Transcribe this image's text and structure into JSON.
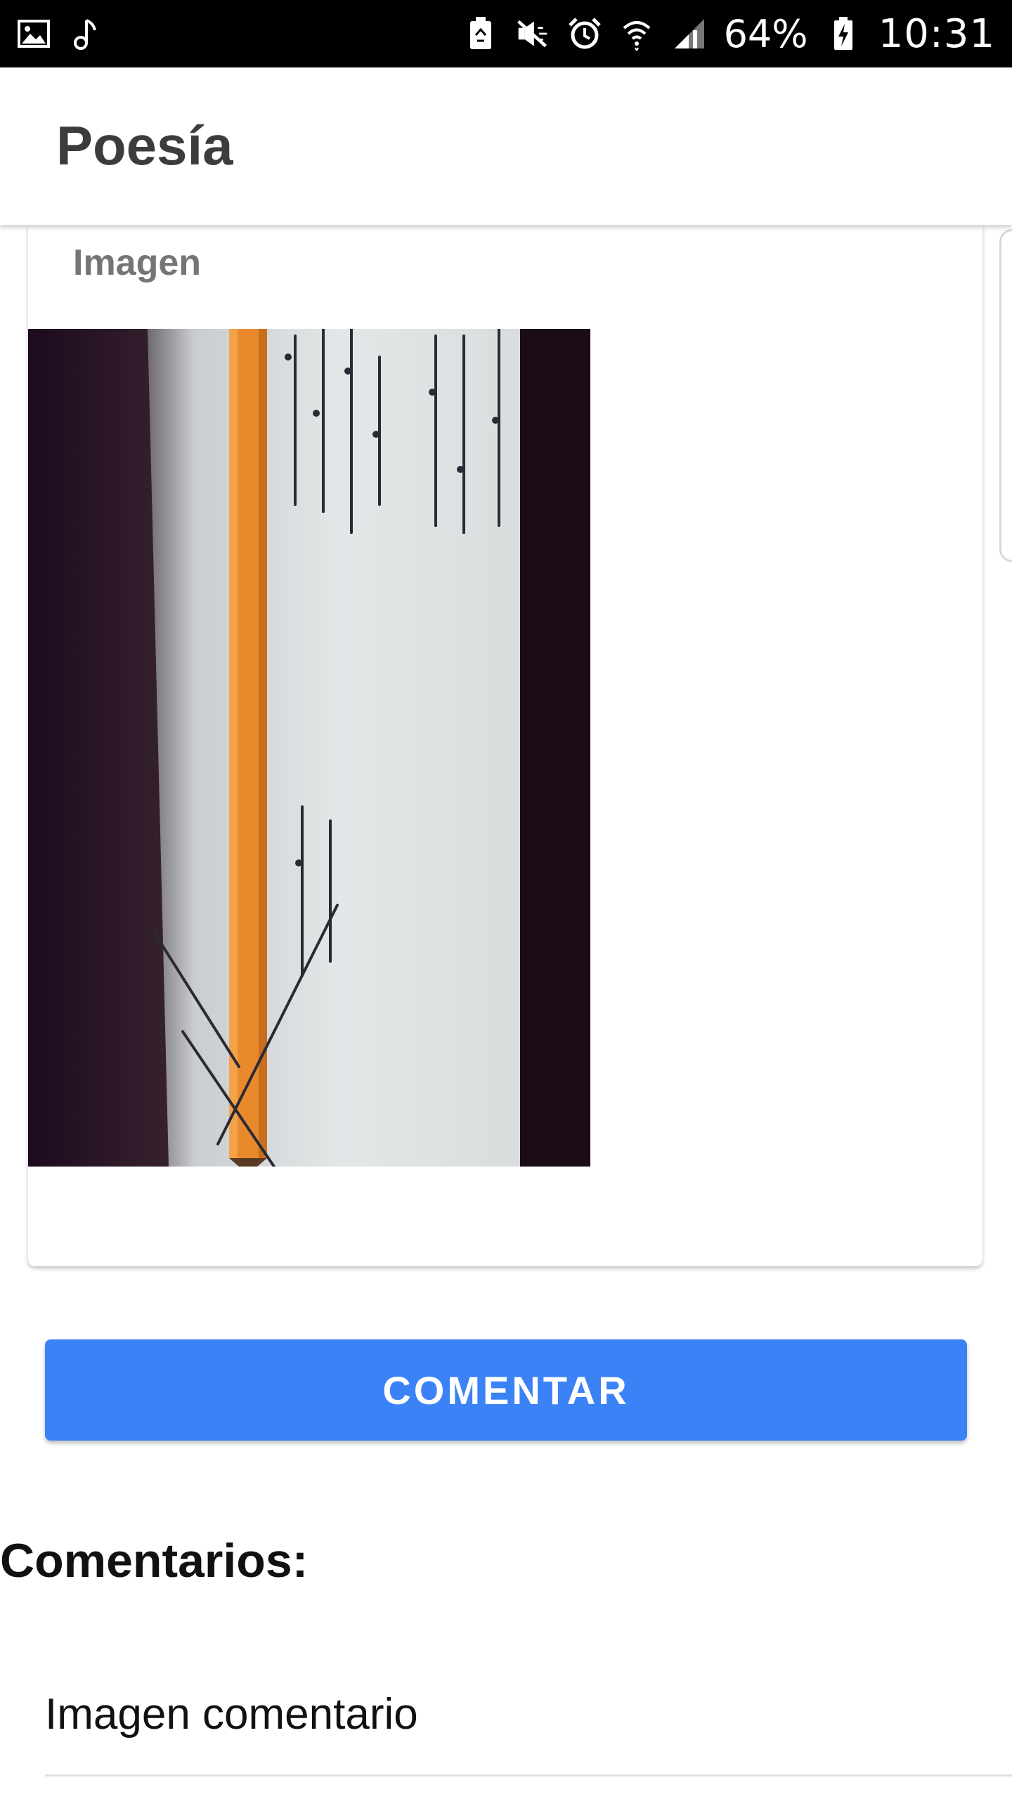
{
  "status_bar": {
    "icons_left": [
      "gallery-icon",
      "music-note-icon"
    ],
    "icons_right": [
      "battery-saver-icon",
      "mute-icon",
      "alarm-icon",
      "wifi-icon",
      "signal-icon"
    ],
    "battery_percent": "64%",
    "battery_icon": "battery-charging-icon",
    "time": "10:31"
  },
  "app_bar": {
    "title": "Poesía"
  },
  "card": {
    "label": "Imagen",
    "image_description": "photo-of-handwritten-notebook-page-with-pencil"
  },
  "actions": {
    "comment_button_label": "COMENTAR"
  },
  "comments": {
    "section_title": "Comentarios:",
    "items": [
      {
        "text": "Imagen comentario"
      }
    ]
  },
  "colors": {
    "status_bar_bg": "#000000",
    "primary_button": "#3b82f6",
    "title_text": "#3c3c3c",
    "label_text": "#757575"
  }
}
